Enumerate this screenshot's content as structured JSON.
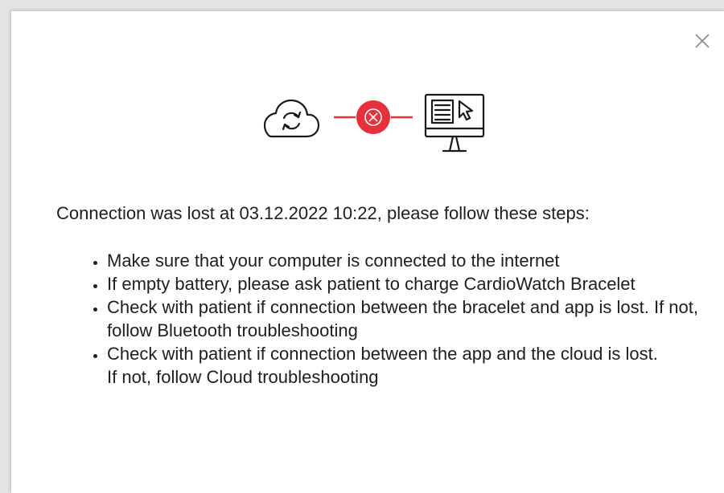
{
  "dialog": {
    "close_label": "×",
    "icons": {
      "cloud": "cloud-sync-icon",
      "error": "connection-error-icon",
      "computer": "computer-monitor-icon",
      "close": "close-icon"
    },
    "colors": {
      "error": "#e8303a",
      "stroke": "#1a1a1a",
      "text": "#1e1e1e"
    },
    "message": "Connection was lost at 03.12.2022 10:22, please follow these steps:",
    "steps": [
      "Make sure that your computer is connected to the internet",
      "If empty battery, please ask patient to charge CardioWatch Bracelet",
      "Check with patient if connection between the bracelet and app is lost. If not, follow Bluetooth troubleshooting",
      "Check with patient if connection between the app and the cloud is lost. If not, follow Cloud troubleshooting"
    ]
  }
}
